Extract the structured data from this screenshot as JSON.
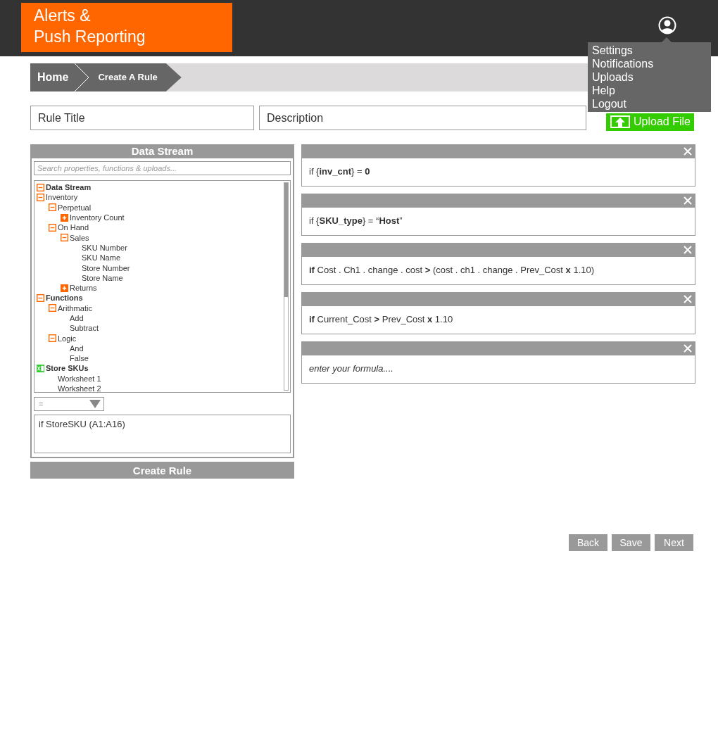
{
  "app": {
    "title_lines": [
      "Alerts &",
      "Push Reporting"
    ]
  },
  "user_menu": {
    "items": [
      "Settings",
      "Notifications",
      "Uploads",
      "Help",
      "Logout"
    ]
  },
  "breadcrumb": [
    "Home",
    "Create A Rule"
  ],
  "form": {
    "rule_title": {
      "placeholder": "Rule Title"
    },
    "description": {
      "placeholder": "Description"
    },
    "upload_button": "Upload File"
  },
  "data_stream": {
    "title": "Data Stream",
    "search": {
      "placeholder": "Search properties, functions & uploads..."
    },
    "tree": [
      {
        "label": "Data Stream",
        "kind": "heading",
        "expanded": true
      },
      {
        "label": "Inventory",
        "kind": "item",
        "expanded": true,
        "children": [
          {
            "label": "Perpetual",
            "kind": "item",
            "expanded": true,
            "children": [
              {
                "label": "Inventory Count",
                "kind": "item",
                "expanded": false
              }
            ]
          },
          {
            "label": "On Hand",
            "kind": "item",
            "expanded": true,
            "children": [
              {
                "label": "Sales",
                "kind": "item",
                "expanded": true,
                "children": [
                  {
                    "label": "SKU Number",
                    "kind": "item"
                  },
                  {
                    "label": "SKU Name",
                    "kind": "item"
                  },
                  {
                    "label": "Store Number",
                    "kind": "item"
                  },
                  {
                    "label": "Store Name",
                    "kind": "item"
                  }
                ]
              },
              {
                "label": "Returns",
                "kind": "item",
                "expanded": false
              }
            ]
          }
        ]
      },
      {
        "label": "Functions",
        "kind": "heading",
        "expanded": true,
        "children": [
          {
            "label": "Arithmatic",
            "kind": "item",
            "expanded": true,
            "children": [
              {
                "label": "Add",
                "kind": "item"
              },
              {
                "label": "Subtract",
                "kind": "item"
              }
            ]
          },
          {
            "label": "Logic",
            "kind": "item",
            "expanded": true,
            "children": [
              {
                "label": "And",
                "kind": "item"
              },
              {
                "label": "False",
                "kind": "item"
              }
            ]
          }
        ]
      },
      {
        "label": "Store SKUs",
        "kind": "sheet",
        "children": [
          {
            "label": "Worksheet 1",
            "kind": "item"
          },
          {
            "label": "Worksheet 2",
            "kind": "item"
          }
        ]
      }
    ],
    "operator": "=",
    "formula": "if StoreSKU (A1:A16)",
    "create_button": "Create Rule"
  },
  "conditions": [
    {
      "kind": "formula",
      "text": "if {**inv_cnt**} = **0**"
    },
    {
      "kind": "formula",
      "text": "if {**SKU_type**} = “**Host**”"
    },
    {
      "kind": "formula",
      "text": "**if** Cost . Ch1 . change . cost **>** (cost . ch1 . change . Prev_Cost **x** 1.10)"
    },
    {
      "kind": "formula",
      "text": "**if** Current_Cost **>** Prev_Cost **x** 1.10"
    },
    {
      "kind": "placeholder",
      "text": "enter your formula...."
    }
  ],
  "nav_buttons": [
    "Back",
    "Save",
    "Next"
  ]
}
